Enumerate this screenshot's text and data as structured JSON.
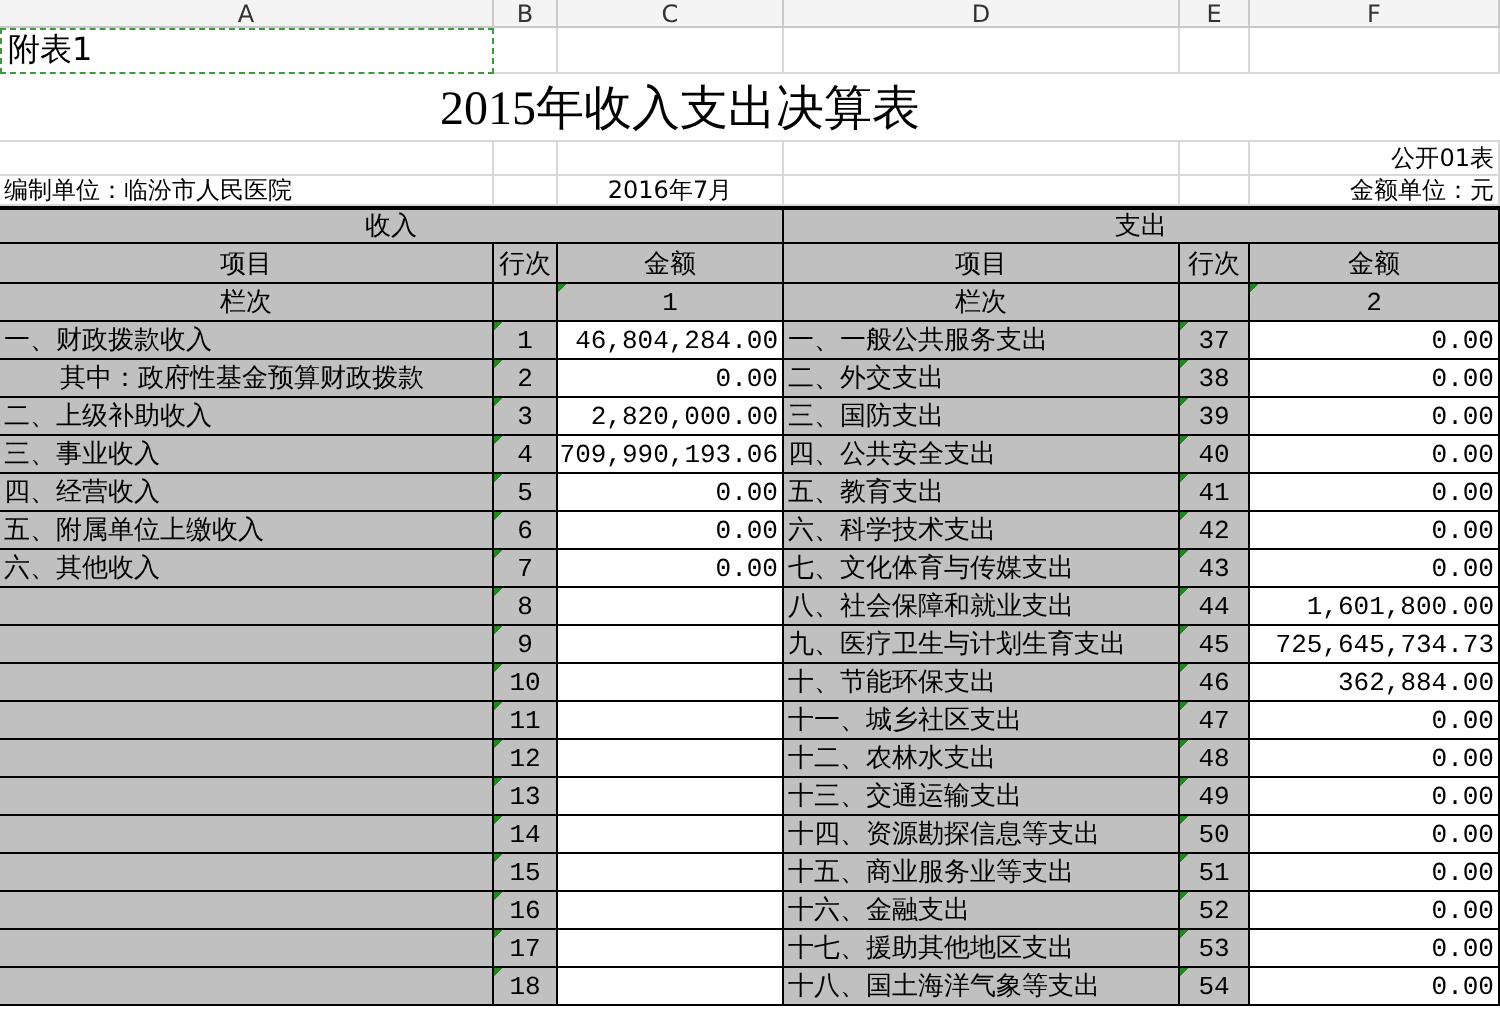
{
  "columns": [
    "A",
    "B",
    "C",
    "D",
    "E",
    "F"
  ],
  "note": {
    "text": "附表1",
    "marquee": true
  },
  "title": "2015年收入支出决算表",
  "form_code": "公开01表",
  "unit": "编制单位：临汾市人民医院",
  "date": "2016年7月",
  "currency": "金额单位：元",
  "income": {
    "heading": "收入",
    "headers": [
      "项目",
      "行次",
      "金额"
    ],
    "index_label": "栏次",
    "index": "1",
    "rows": [
      {
        "item": "一、财政拨款收入",
        "line": "1",
        "amount": "46,804,284.00",
        "children": [
          {
            "item": "其中：政府性基金预算财政拨款",
            "line": "2",
            "amount": "0.00"
          }
        ]
      },
      {
        "item": "二、上级补助收入",
        "line": "3",
        "amount": "2,820,000.00"
      },
      {
        "item": "三、事业收入",
        "line": "4",
        "amount": "709,990,193.06"
      },
      {
        "item": "四、经营收入",
        "line": "5",
        "amount": "0.00"
      },
      {
        "item": "五、附属单位上缴收入",
        "line": "6",
        "amount": "0.00"
      },
      {
        "item": "六、其他收入",
        "line": "7",
        "amount": "0.00"
      },
      {
        "line": "8"
      },
      {
        "line": "9"
      },
      {
        "line": "10"
      },
      {
        "line": "11"
      },
      {
        "line": "12"
      },
      {
        "line": "13"
      },
      {
        "line": "14"
      },
      {
        "line": "15"
      },
      {
        "line": "16"
      },
      {
        "line": "17"
      },
      {
        "line": "18"
      }
    ]
  },
  "expenditure": {
    "heading": "支出",
    "headers": [
      "项目",
      "行次",
      "金额"
    ],
    "index_label": "栏次",
    "index": "2",
    "rows": [
      {
        "item": "一、一般公共服务支出",
        "line": "37",
        "amount": "0.00"
      },
      {
        "item": "二、外交支出",
        "line": "38",
        "amount": "0.00"
      },
      {
        "item": "三、国防支出",
        "line": "39",
        "amount": "0.00"
      },
      {
        "item": "四、公共安全支出",
        "line": "40",
        "amount": "0.00"
      },
      {
        "item": "五、教育支出",
        "line": "41",
        "amount": "0.00"
      },
      {
        "item": "六、科学技术支出",
        "line": "42",
        "amount": "0.00"
      },
      {
        "item": "七、文化体育与传媒支出",
        "line": "43",
        "amount": "0.00"
      },
      {
        "item": "八、社会保障和就业支出",
        "line": "44",
        "amount": "1,601,800.00"
      },
      {
        "item": "九、医疗卫生与计划生育支出",
        "line": "45",
        "amount": "725,645,734.73"
      },
      {
        "item": "十、节能环保支出",
        "line": "46",
        "amount": "362,884.00"
      },
      {
        "item": "十一、城乡社区支出",
        "line": "47",
        "amount": "0.00"
      },
      {
        "item": "十二、农林水支出",
        "line": "48",
        "amount": "0.00"
      },
      {
        "item": "十三、交通运输支出",
        "line": "49",
        "amount": "0.00"
      },
      {
        "item": "十四、资源勘探信息等支出",
        "line": "50",
        "amount": "0.00"
      },
      {
        "item": "十五、商业服务业等支出",
        "line": "51",
        "amount": "0.00"
      },
      {
        "item": "十六、金融支出",
        "line": "52",
        "amount": "0.00"
      },
      {
        "item": "十七、援助其他地区支出",
        "line": "53",
        "amount": "0.00"
      },
      {
        "item": "十八、国土海洋气象等支出",
        "line": "54",
        "amount": "0.00"
      }
    ]
  }
}
